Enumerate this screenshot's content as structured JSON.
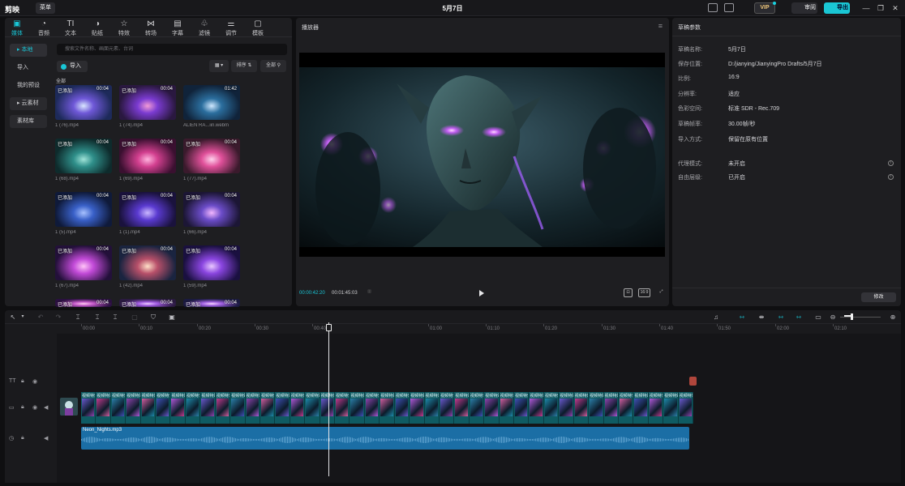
{
  "app": {
    "logo": "剪映",
    "menu_label": "菜单",
    "window_title": "5月7日",
    "vip_label": "VIP",
    "review_label": "审阅",
    "export_label": "导出",
    "win_min": "—",
    "win_max": "❐",
    "win_close": "✕"
  },
  "toolbar": [
    {
      "label": "媒体",
      "icon": "media-icon",
      "glyph": "▣",
      "active": true
    },
    {
      "label": "音频",
      "icon": "audio-icon",
      "glyph": "◔"
    },
    {
      "label": "文本",
      "icon": "text-icon",
      "glyph": "TI"
    },
    {
      "label": "贴纸",
      "icon": "sticker-icon",
      "glyph": "◑"
    },
    {
      "label": "特效",
      "icon": "effects-icon",
      "glyph": "☆"
    },
    {
      "label": "转场",
      "icon": "transition-icon",
      "glyph": "⋈"
    },
    {
      "label": "字幕",
      "icon": "caption-icon",
      "glyph": "▤"
    },
    {
      "label": "滤镜",
      "icon": "filter-icon",
      "glyph": "♧"
    },
    {
      "label": "调节",
      "icon": "adjust-icon",
      "glyph": "⚌"
    },
    {
      "label": "模板",
      "icon": "template-icon",
      "glyph": "▢"
    }
  ],
  "media_nav": [
    {
      "label": "本地",
      "active": true
    },
    {
      "label": "导入"
    },
    {
      "label": "我的预设"
    },
    {
      "label": "云素材"
    },
    {
      "label": "素材库"
    }
  ],
  "media": {
    "search_placeholder": "搜索文件名称、画面元素、台词",
    "import_label": "导入",
    "sort_label": "排序",
    "filter_label": "全部",
    "all_label": "全部",
    "items": [
      {
        "name": "1 (76).mp4",
        "duration": "00:04",
        "added": "已添加"
      },
      {
        "name": "1 (74).mp4",
        "duration": "00:04",
        "added": "已添加"
      },
      {
        "name": "ALIEN RA...iin.webm",
        "duration": "01:42",
        "added": ""
      },
      {
        "name": "1 (68).mp4",
        "duration": "00:04",
        "added": "已添加"
      },
      {
        "name": "1 (69).mp4",
        "duration": "00:04",
        "added": "已添加"
      },
      {
        "name": "1 (77).mp4",
        "duration": "00:04",
        "added": "已添加"
      },
      {
        "name": "1 (5).mp4",
        "duration": "00:04",
        "added": "已添加"
      },
      {
        "name": "1 (1).mp4",
        "duration": "00:04",
        "added": "已添加"
      },
      {
        "name": "1 (66).mp4",
        "duration": "00:04",
        "added": "已添加"
      },
      {
        "name": "1 (67).mp4",
        "duration": "00:04",
        "added": "已添加"
      },
      {
        "name": "1 (42).mp4",
        "duration": "00:04",
        "added": "已添加"
      },
      {
        "name": "1 (59).mp4",
        "duration": "00:04",
        "added": "已添加"
      },
      {
        "name": "",
        "duration": "00:04",
        "added": "已添加"
      },
      {
        "name": "",
        "duration": "00:04",
        "added": "已添加"
      },
      {
        "name": "",
        "duration": "00:04",
        "added": "已添加"
      }
    ]
  },
  "player": {
    "title": "播放器",
    "current_time": "00:00:42:20",
    "total_time": "00:01:45:03",
    "ratio_label": "比例"
  },
  "draft": {
    "title": "草稿参数",
    "params": [
      {
        "key": "草稿名称:",
        "value": "5月7日"
      },
      {
        "key": "保存位置:",
        "value": "D:/jianying/JianyingPro Drafts/5月7日"
      },
      {
        "key": "比例:",
        "value": "16:9"
      },
      {
        "key": "分辨率:",
        "value": "适应"
      },
      {
        "key": "色彩空间:",
        "value": "标准 SDR - Rec.709"
      },
      {
        "key": "草稿帧率:",
        "value": "30.00帧/秒"
      },
      {
        "key": "导入方式:",
        "value": "保留在原有位置"
      },
      {
        "key": "代理模式:",
        "value": "未开启",
        "info": true
      },
      {
        "key": "自由层级:",
        "value": "已开启",
        "info": true
      }
    ],
    "modify_label": "修改"
  },
  "timeline": {
    "ticks": [
      "00:00",
      "00:10",
      "00:20",
      "00:30",
      "00:40",
      "01:00",
      "01:10",
      "01:20",
      "01:30",
      "01:40",
      "01:50",
      "02:00",
      "02:10"
    ],
    "clip_title": "视频特效",
    "clip_count": 41,
    "audio_name": "Neon_Nights.mp3"
  },
  "colors": {
    "accent": "#19c6d6",
    "clip": "#0f5b63",
    "audio": "#1b6ea5",
    "text_clip": "#b0463c"
  }
}
